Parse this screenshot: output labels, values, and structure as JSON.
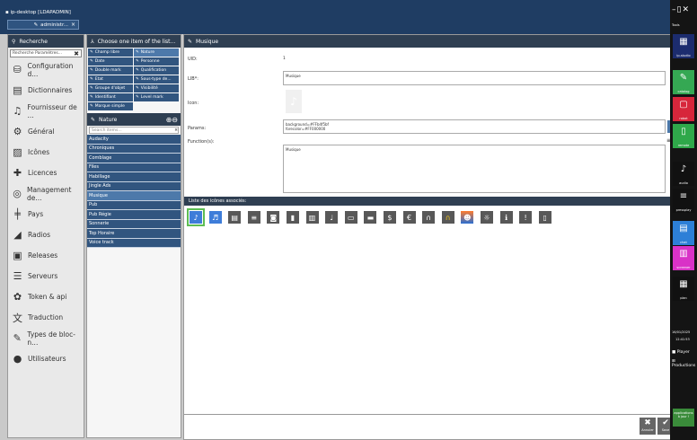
{
  "window": {
    "title": "ip-desktop [LDAPADMIN]",
    "tab_label": "administr...",
    "tab_close": "×"
  },
  "left": {
    "header": "Recherche",
    "search_placeholder": "Recherche Paramètres...",
    "search_clear": "✖",
    "items": [
      {
        "label": "Configuration d...",
        "icon": "database-icon",
        "glyph": "⛁"
      },
      {
        "label": "Dictionnaires",
        "icon": "book-icon",
        "glyph": "▤"
      },
      {
        "label": "Fournisseur de ...",
        "icon": "music-icon",
        "glyph": "♫"
      },
      {
        "label": "Général",
        "icon": "gear-icon",
        "glyph": "⚙"
      },
      {
        "label": "Icônes",
        "icon": "image-icon",
        "glyph": "▨"
      },
      {
        "label": "Licences",
        "icon": "puzzle-icon",
        "glyph": "✚"
      },
      {
        "label": "Management de...",
        "icon": "radio-signal-icon",
        "glyph": "◎"
      },
      {
        "label": "Pays",
        "icon": "signpost-icon",
        "glyph": "╪"
      },
      {
        "label": "Radios",
        "icon": "broadcast-icon",
        "glyph": "◢"
      },
      {
        "label": "Releases",
        "icon": "box-icon",
        "glyph": "▣"
      },
      {
        "label": "Serveurs",
        "icon": "server-icon",
        "glyph": "☰"
      },
      {
        "label": "Token & api",
        "icon": "gear-key-icon",
        "glyph": "✿"
      },
      {
        "label": "Traduction",
        "icon": "translate-icon",
        "glyph": "文"
      },
      {
        "label": "Types de bloc-n...",
        "icon": "pin-icon",
        "glyph": "✎"
      },
      {
        "label": "Utilisateurs",
        "icon": "user-icon",
        "glyph": "●"
      }
    ]
  },
  "middle": {
    "header": "Choose one item of the list...",
    "tags": [
      {
        "label": "Champ libre"
      },
      {
        "label": "Nature",
        "selected": true
      },
      {
        "label": "Date"
      },
      {
        "label": "Personne"
      },
      {
        "label": "Double mark"
      },
      {
        "label": "Qualification"
      },
      {
        "label": "Etat"
      },
      {
        "label": "Sous-type de..."
      },
      {
        "label": "Groupe d'objet"
      },
      {
        "label": "Visibilité"
      },
      {
        "label": "Identifiant"
      },
      {
        "label": "Level mark"
      },
      {
        "label": "Marque simple"
      }
    ],
    "nature_header": "Nature",
    "nature_controls": "⊕⊖",
    "nature_search_placeholder": "Search items...",
    "nature_items": [
      {
        "label": "Audacity"
      },
      {
        "label": "Chroniques"
      },
      {
        "label": "Comblage"
      },
      {
        "label": "Files"
      },
      {
        "label": "Habillage"
      },
      {
        "label": "Jingle Ads"
      },
      {
        "label": "Musique",
        "selected": true
      },
      {
        "label": "Pub"
      },
      {
        "label": "Pub Régie"
      },
      {
        "label": "Sonnerie"
      },
      {
        "label": "Top Horaire"
      },
      {
        "label": "Voice track"
      }
    ]
  },
  "form": {
    "header": "Musique",
    "uid_label": "UID:",
    "uid_value": "1",
    "lib_label": "LIB*:",
    "lib_value": "Musique",
    "icon_label": "Icon:",
    "params_label": "Params:",
    "params_line1": "background=#FFb4f5bf",
    "params_line2": "forecolor=#FF000000",
    "functions_label": "Function(s):",
    "functions_value": "Musique",
    "icons_section": "Liste des icônes associés:",
    "icons": [
      {
        "name": "music-note-icon",
        "glyph": "♪",
        "style": "blue",
        "selected": true
      },
      {
        "name": "music-notes-icon",
        "glyph": "♬",
        "style": "blue"
      },
      {
        "name": "music-file-icon",
        "glyph": "▤",
        "style": "dark"
      },
      {
        "name": "playlist-icon",
        "glyph": "≡",
        "style": "dark"
      },
      {
        "name": "album-icon",
        "glyph": "◙",
        "style": "dark"
      },
      {
        "name": "document-icon",
        "glyph": "▮",
        "style": "dark"
      },
      {
        "name": "audio-file-icon",
        "glyph": "▥",
        "style": "dark"
      },
      {
        "name": "microphone-icon",
        "glyph": "♩",
        "style": "dark"
      },
      {
        "name": "tape-icon",
        "glyph": "▭",
        "style": "dark"
      },
      {
        "name": "cassette-icon",
        "glyph": "▬",
        "style": "dark"
      },
      {
        "name": "dollar-icon",
        "glyph": "$",
        "style": "dark"
      },
      {
        "name": "euro-icon",
        "glyph": "€",
        "style": "dark"
      },
      {
        "name": "headphones-icon",
        "glyph": "∩",
        "style": "dark"
      },
      {
        "name": "headphones-yellow-icon",
        "glyph": "∩",
        "style": "yellow"
      },
      {
        "name": "avatar-headphones-icon",
        "glyph": "☻",
        "style": "multi"
      },
      {
        "name": "sun-icon",
        "glyph": "☼",
        "style": "dark"
      },
      {
        "name": "info-icon",
        "glyph": "ℹ",
        "style": "dark"
      },
      {
        "name": "exclamation-icon",
        "glyph": "!",
        "style": "dark"
      },
      {
        "name": "open-book-icon",
        "glyph": "▯",
        "style": "dark"
      }
    ],
    "cancel_label": "Annuler",
    "save_label": "Save"
  },
  "sidebar": {
    "top_label": "Tools",
    "buttons": [
      {
        "label": "ip-studio",
        "color": "#1c2c6e",
        "glyph": "▦"
      },
      {
        "label": "catalog",
        "color": "#35a853",
        "glyph": "✎"
      },
      {
        "label": "robot",
        "color": "#d7263b",
        "glyph": "▢"
      },
      {
        "label": "remote",
        "color": "#2fa84a",
        "glyph": "▯"
      },
      {
        "label": "audio",
        "color": "#111",
        "glyph": "♪"
      },
      {
        "label": "pressplay",
        "color": "#111",
        "glyph": "≡"
      },
      {
        "label": "chat",
        "color": "#2d7fd7",
        "glyph": "▤"
      },
      {
        "label": "screener",
        "color": "#d932c7",
        "glyph": "▥"
      },
      {
        "label": "plan",
        "color": "#111",
        "glyph": "▦"
      }
    ],
    "date": "16/01/2025",
    "time": "12:41:53",
    "player": "Player",
    "product": "Productions",
    "apply": "applications à jour !"
  }
}
